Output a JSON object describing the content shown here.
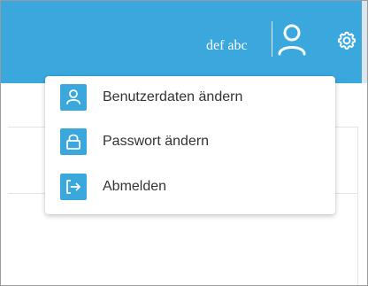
{
  "header": {
    "username": "def abc",
    "user_icon": "user-icon",
    "settings_icon": "gear-icon",
    "accent_color": "#3aa7dd"
  },
  "user_menu": {
    "items": [
      {
        "label": "Benutzerdaten ändern",
        "icon": "user-icon"
      },
      {
        "label": "Passwort ändern",
        "icon": "lock-icon"
      },
      {
        "label": "Abmelden",
        "icon": "logout-icon"
      }
    ]
  }
}
